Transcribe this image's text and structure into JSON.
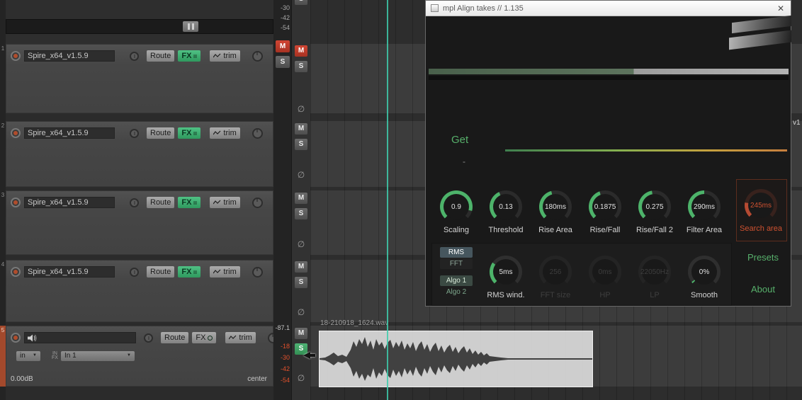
{
  "colors": {
    "accent_green": "#57b06b",
    "warn_red": "#ce5130",
    "mute_red": "#c0392b",
    "cursor_teal": "#3ecdad"
  },
  "labels": {
    "mute": "M",
    "solo": "S",
    "fx_bypass": "∅",
    "route": "Route",
    "fx": "FX",
    "trim": "trim",
    "dropdown_arrow": "▼"
  },
  "tracks": [
    {
      "num": "1",
      "name": "Spire_x64_v1.5.9"
    },
    {
      "num": "2",
      "name": "Spire_x64_v1.5.9"
    },
    {
      "num": "3",
      "name": "Spire_x64_v1.5.9"
    },
    {
      "num": "4",
      "name": "Spire_x64_v1.5.9"
    }
  ],
  "track5": {
    "num": "5",
    "volume": "0.00dB",
    "pan": "center",
    "input_mode": "in",
    "infx_line1": "IN",
    "infx_line2": "FX",
    "input_name": "In 1"
  },
  "meter": {
    "top_scale": [
      "-30",
      "-42",
      "-54"
    ],
    "peak_readout": "-87.1",
    "red_scale": [
      "-18",
      "-30",
      "-42",
      "-54"
    ]
  },
  "plugin": {
    "title": "mpl Align takes // 1.135",
    "close": "✕",
    "get": "Get",
    "dash": "-",
    "knobs": [
      {
        "value": "0.9",
        "label": "Scaling",
        "arc": 240
      },
      {
        "value": "0.13",
        "label": "Threshold",
        "arc": 110
      },
      {
        "value": "180ms",
        "label": "Rise Area",
        "arc": 120
      },
      {
        "value": "0.1875",
        "label": "Rise/Fall",
        "arc": 115
      },
      {
        "value": "0.275",
        "label": "Rise/Fall 2",
        "arc": 125
      },
      {
        "value": "290ms",
        "label": "Filter Area",
        "arc": 135
      }
    ],
    "search_knob": {
      "value": "245ms",
      "label": "Search area",
      "arc": 55
    },
    "mode_rms": "RMS",
    "mode_fft": "FFT",
    "algo1": "Algo 1",
    "algo2": "Algo 2",
    "row2_knobs": [
      {
        "value": "5ms",
        "label": "RMS wind.",
        "arc": 80
      },
      {
        "value": "256",
        "label": "FFT size",
        "arc": 0
      },
      {
        "value": "0ms",
        "label": "HP",
        "arc": 0
      },
      {
        "value": "22050Hz",
        "label": "LP",
        "arc": 0
      },
      {
        "value": "0%",
        "label": "Smooth",
        "arc": 6
      }
    ],
    "presets": "Presets",
    "about": "About"
  },
  "media_item": {
    "filename": "18-210918_1624.wav"
  },
  "arrange": {
    "clipped_track_label": "v1"
  }
}
